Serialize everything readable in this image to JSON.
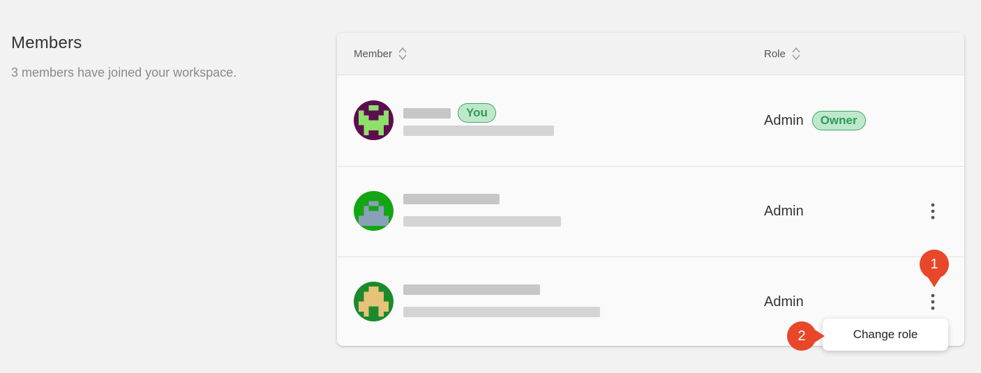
{
  "section": {
    "title": "Members",
    "subtitle": "3 members have joined your workspace."
  },
  "table": {
    "columns": [
      {
        "label": "Member",
        "sortable": true
      },
      {
        "label": "Role",
        "sortable": true
      }
    ],
    "rows": [
      {
        "name": "",
        "email": "",
        "self_badge": "You",
        "role": "Admin",
        "role_badge": "Owner",
        "has_menu": false,
        "avatar": "purple-green-identicon"
      },
      {
        "name": "",
        "email": "",
        "self_badge": "",
        "role": "Admin",
        "role_badge": "",
        "has_menu": true,
        "avatar": "green-slate-identicon"
      },
      {
        "name": "",
        "email": "",
        "self_badge": "",
        "role": "Admin",
        "role_badge": "",
        "has_menu": true,
        "avatar": "green-tan-identicon"
      }
    ]
  },
  "menu": {
    "items": [
      "Change role"
    ]
  },
  "annotations": {
    "step1": "1",
    "step2": "2"
  },
  "colors": {
    "badge_text": "#2e9a5a",
    "badge_bg": "#bfe8cb",
    "marker": "#e8472a"
  }
}
